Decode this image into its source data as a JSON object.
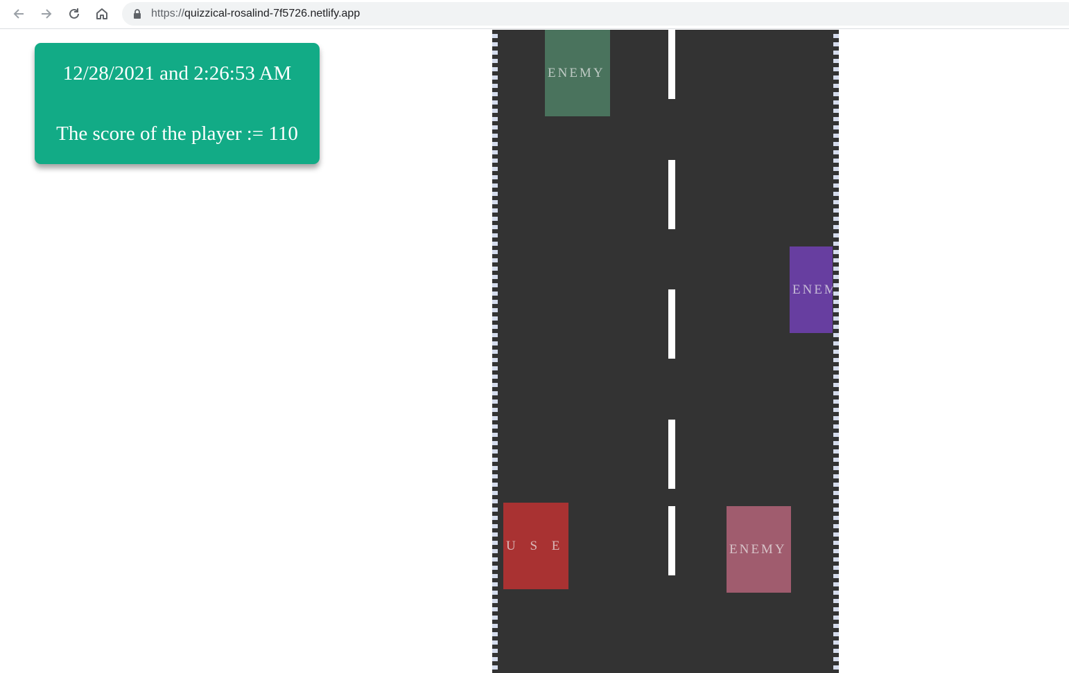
{
  "browser": {
    "url_prefix": "https://",
    "url_host": "quizzical-rosalind-7f5726.netlify.app",
    "icons": [
      "back-arrow-icon",
      "forward-arrow-icon",
      "reload-icon",
      "home-icon",
      "lock-icon"
    ]
  },
  "hud": {
    "datetime": "12/28/2021 and 2:26:53 AM",
    "score": "The score of the player := 110",
    "background": "#12ab86"
  },
  "road": {
    "asphalt": "#333333",
    "curb_stripe": "#d5dced",
    "lane_line": "#ffffff"
  },
  "cars": {
    "user": {
      "label": "U S E R",
      "color": "#a93232"
    },
    "enemy_top": {
      "label": "ENEMY",
      "color": "#4a735d"
    },
    "enemy_mid": {
      "label": "ENEMY",
      "color": "#673ea0"
    },
    "enemy_bottom": {
      "label": "ENEMY",
      "color": "#a05c6e"
    }
  }
}
